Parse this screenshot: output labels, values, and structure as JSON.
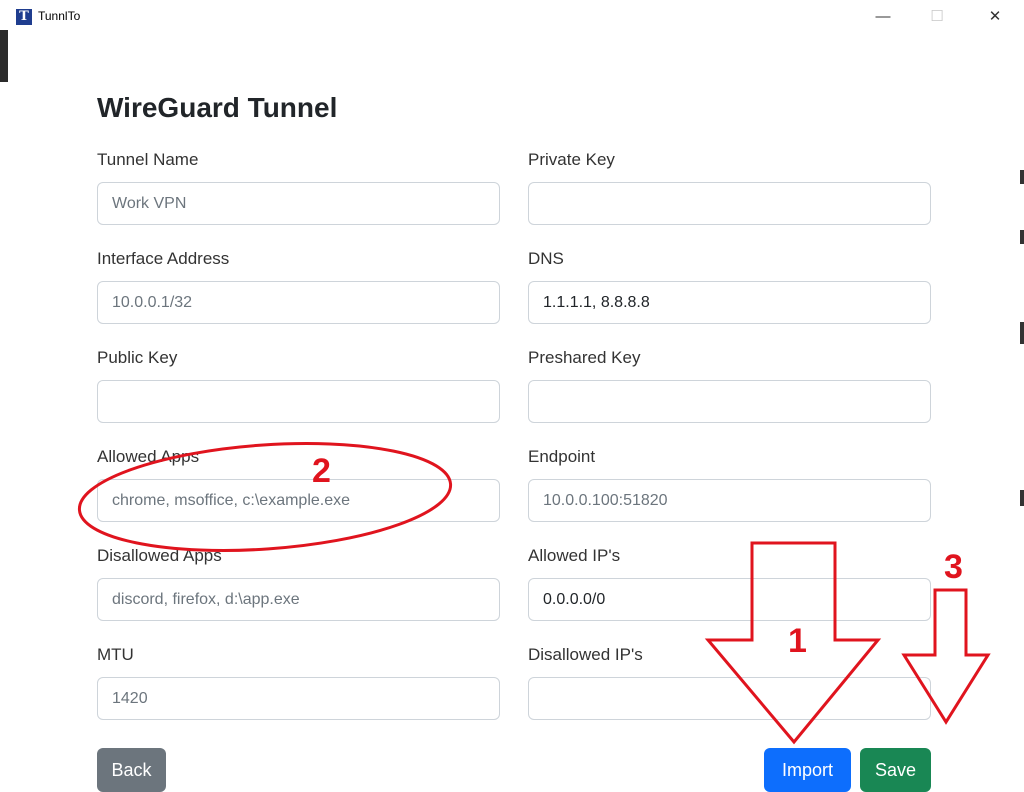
{
  "window": {
    "title": "TunnlTo",
    "icon_letter": "T",
    "minimize_glyph": "—",
    "maximize_glyph": "☐",
    "close_glyph": "✕"
  },
  "page": {
    "heading": "WireGuard Tunnel"
  },
  "form": {
    "tunnel_name": {
      "label": "Tunnel Name",
      "value": "",
      "placeholder": "Work VPN"
    },
    "private_key": {
      "label": "Private Key",
      "value": "",
      "placeholder": ""
    },
    "interface_address": {
      "label": "Interface Address",
      "value": "",
      "placeholder": "10.0.0.1/32"
    },
    "dns": {
      "label": "DNS",
      "value": "1.1.1.1, 8.8.8.8",
      "placeholder": ""
    },
    "public_key": {
      "label": "Public Key",
      "value": "",
      "placeholder": ""
    },
    "preshared_key": {
      "label": "Preshared Key",
      "value": "",
      "placeholder": ""
    },
    "allowed_apps": {
      "label": "Allowed Apps",
      "value": "",
      "placeholder": "chrome, msoffice, c:\\example.exe"
    },
    "endpoint": {
      "label": "Endpoint",
      "value": "",
      "placeholder": "10.0.0.100:51820"
    },
    "disallowed_apps": {
      "label": "Disallowed Apps",
      "value": "",
      "placeholder": "discord, firefox, d:\\app.exe"
    },
    "allowed_ips": {
      "label": "Allowed IP's",
      "value": "0.0.0.0/0",
      "placeholder": ""
    },
    "mtu": {
      "label": "MTU",
      "value": "",
      "placeholder": "1420"
    },
    "disallowed_ips": {
      "label": "Disallowed IP's",
      "value": "",
      "placeholder": ""
    }
  },
  "buttons": {
    "back": "Back",
    "import": "Import",
    "save": "Save"
  },
  "annotations": {
    "n1": "1",
    "n2": "2",
    "n3": "3",
    "color": "#e0141e"
  },
  "colors": {
    "primary": "#0d6efd",
    "success": "#198754",
    "secondary": "#6c757d"
  }
}
